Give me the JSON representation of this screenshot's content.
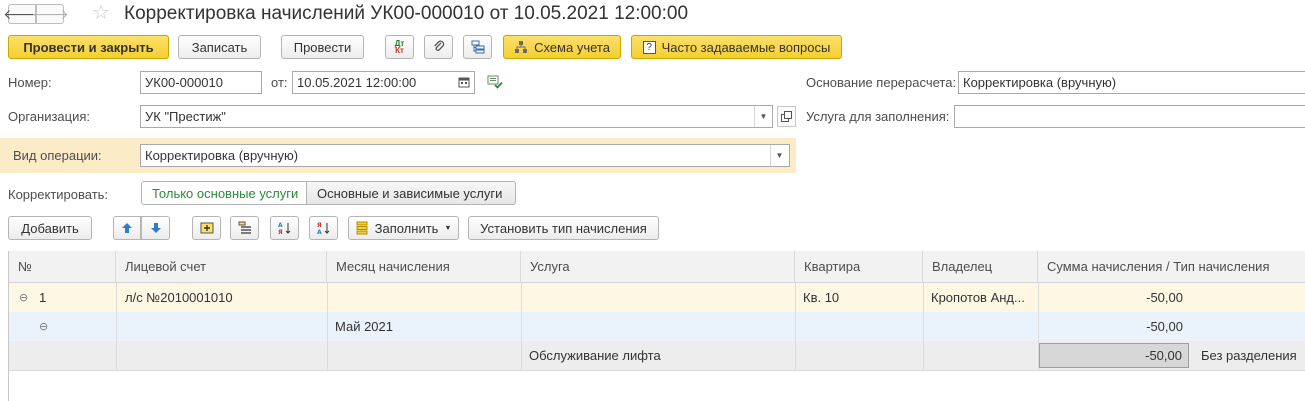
{
  "window": {
    "title": "Корректировка начислений УК00-000010 от 10.05.2021 12:00:00",
    "back_glyph": "🡐",
    "forward_glyph": "🡒",
    "star_glyph": "☆"
  },
  "toolbar": {
    "post_close": "Провести и закрыть",
    "save": "Записать",
    "post": "Провести",
    "dt_kt_top": "Дт",
    "dt_kt_bottom": "Кт",
    "scheme": "Схема учета",
    "faq": "Часто задаваемые вопросы",
    "faq_icon": "?"
  },
  "form": {
    "number_label": "Номер:",
    "number_value": "УК00-000010",
    "date_label": "от:",
    "date_value": "10.05.2021 12:00:00",
    "org_label": "Организация:",
    "org_value": "УК \"Престиж\"",
    "operation_label": "Вид операции:",
    "operation_value": "Корректировка (вручную)",
    "correct_label": "Корректировать:",
    "toggle_main": "Только основные услуги",
    "toggle_dependent": "Основные и зависимые услуги",
    "recalc_label": "Основание перерасчета:",
    "recalc_value": "Корректировка (вручную)",
    "service_label": "Услуга для заполнения:",
    "service_value": ""
  },
  "table_toolbar": {
    "add": "Добавить",
    "fill": "Заполнить",
    "set_type": "Установить тип начисления"
  },
  "table": {
    "columns": [
      "№",
      "Лицевой счет",
      "Месяц начисления",
      "Услуга",
      "Квартира",
      "Владелец",
      "Сумма начисления / Тип начисления"
    ],
    "rows": [
      {
        "expander": "⊖",
        "num": "1",
        "account": "л/с №2010001010",
        "month": "",
        "service": "",
        "flat": "Кв. 10",
        "owner": "Кропотов Анд...",
        "sum": "-50,00",
        "type": ""
      },
      {
        "expander": "⊖",
        "num": "",
        "account": "",
        "month": "Май 2021",
        "service": "",
        "flat": "",
        "owner": "",
        "sum": "-50,00",
        "type": ""
      },
      {
        "expander": "",
        "num": "",
        "account": "",
        "month": "",
        "service": "Обслуживание лифта",
        "flat": "",
        "owner": "",
        "sum": "-50,00",
        "type": "Без разделения"
      }
    ]
  },
  "colors": {
    "accent_yellow": "#f5cf2f",
    "operation_band": "#fbecc7",
    "row_group": "#fdf7e4",
    "row_sub": "#eaf2fb",
    "row_leaf": "#ededed",
    "toggle_active_text": "#2c8a3c"
  }
}
